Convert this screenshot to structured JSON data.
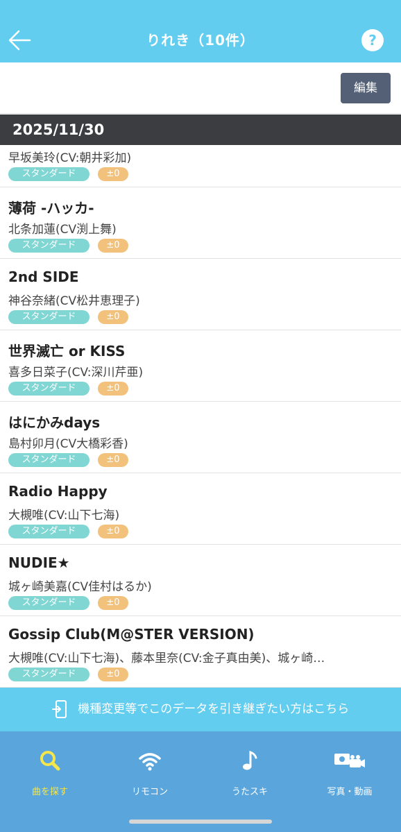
{
  "header": {
    "title": "りれき（10件）",
    "help_label": "?"
  },
  "toolbar": {
    "edit_label": "編集"
  },
  "date_section": {
    "date": "2025/11/30"
  },
  "history": [
    {
      "title": "",
      "artist": "早坂美玲(CV:朝井彩加)",
      "type": "スタンダード",
      "key": "±0"
    },
    {
      "title": "薄荷 -ハッカ-",
      "artist": "北条加蓮(CV渕上舞)",
      "type": "スタンダード",
      "key": "±0"
    },
    {
      "title": "2nd SIDE",
      "artist": "神谷奈緒(CV松井恵理子)",
      "type": "スタンダード",
      "key": "±0"
    },
    {
      "title": "世界滅亡 or KISS",
      "artist": "喜多日菜子(CV:深川芹亜)",
      "type": "スタンダード",
      "key": "±0"
    },
    {
      "title": "はにかみdays",
      "artist": "島村卯月(CV大橋彩香)",
      "type": "スタンダード",
      "key": "±0"
    },
    {
      "title": "Radio Happy",
      "artist": "大槻唯(CV:山下七海)",
      "type": "スタンダード",
      "key": "±0"
    },
    {
      "title": "NUDIE★",
      "artist": "城ヶ崎美嘉(CV佳村はるか)",
      "type": "スタンダード",
      "key": "±0"
    },
    {
      "title": "Gossip Club(M@STER VERSION)",
      "artist": "大槻唯(CV:山下七海)、藤本里奈(CV:金子真由美)、城ヶ崎…",
      "type": "スタンダード",
      "key": "±0"
    }
  ],
  "transfer": {
    "label": "機種変更等でこのデータを引き継ぎたい方はこちら"
  },
  "tabs": [
    {
      "label": "曲を探す",
      "icon": "search-icon",
      "active": true
    },
    {
      "label": "リモコン",
      "icon": "wifi-icon",
      "active": false
    },
    {
      "label": "うたスキ",
      "icon": "music-note-icon",
      "active": false
    },
    {
      "label": "写真・動画",
      "icon": "camera-video-icon",
      "active": false
    }
  ],
  "colors": {
    "header": "#62cdef",
    "date_bar": "#3c3d41",
    "tabbar": "#5aa6dc",
    "active_tab": "#f5e64b",
    "badge_type": "#7fd6d3",
    "badge_key": "#f2c27d"
  }
}
